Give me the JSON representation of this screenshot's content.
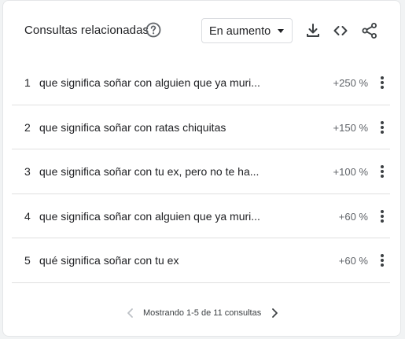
{
  "widget": {
    "title": "Consultas relacionadas",
    "help_icon": "help-circle-icon",
    "filter": {
      "selected": "En aumento"
    },
    "tools": [
      {
        "name": "download-icon"
      },
      {
        "name": "embed-code-icon"
      },
      {
        "name": "share-icon"
      }
    ]
  },
  "rows": [
    {
      "rank": "1",
      "query": "que significa soñar con alguien que ya muri...",
      "value": "+250 %"
    },
    {
      "rank": "2",
      "query": "que significa soñar con ratas chiquitas",
      "value": "+150 %"
    },
    {
      "rank": "3",
      "query": "que significa soñar con tu ex, pero no te ha...",
      "value": "+100 %"
    },
    {
      "rank": "4",
      "query": "que significa soñar con alguien que ya muri...",
      "value": "+60 %"
    },
    {
      "rank": "5",
      "query": "qué significa soñar con tu ex",
      "value": "+60 %"
    }
  ],
  "pagination": {
    "text": "Mostrando 1-5 de 11 consultas",
    "prev_icon": "chevron-left-icon",
    "next_icon": "chevron-right-icon"
  },
  "colors": {
    "text": "#202124",
    "secondary": "#5f6368",
    "disabled": "#bdc1c6",
    "divider": "#e0e0e0"
  }
}
